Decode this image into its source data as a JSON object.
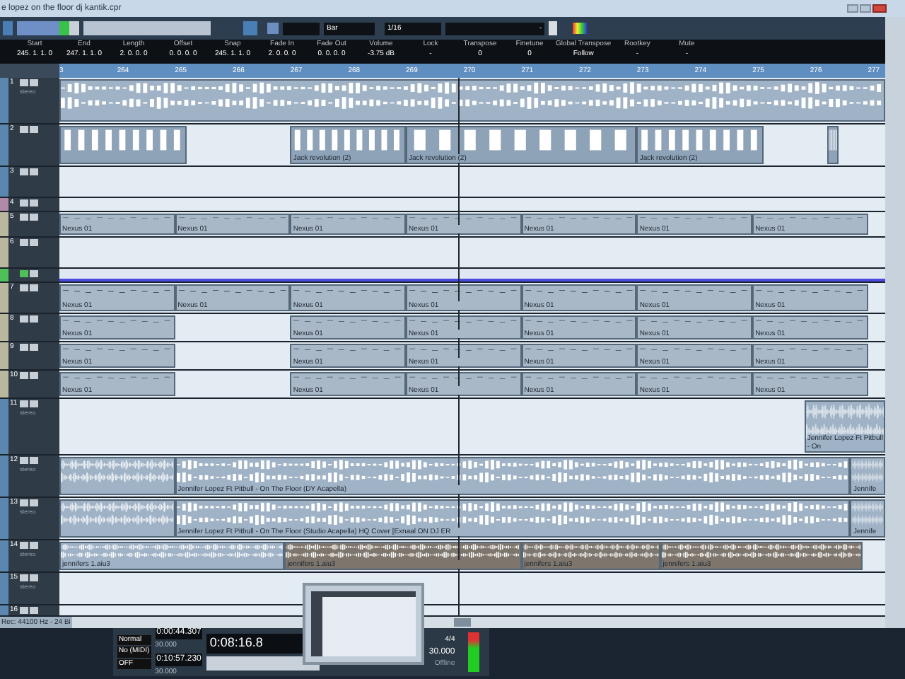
{
  "window": {
    "title": "e lopez on the floor dj kantik.cpr"
  },
  "toolbar": {
    "snap_type": "Bar",
    "quantize": "1/16",
    "nudge": "-"
  },
  "info_line": [
    {
      "label": "Start",
      "value": "245. 1. 1. 0"
    },
    {
      "label": "End",
      "value": "247. 1. 1. 0"
    },
    {
      "label": "Length",
      "value": "2. 0. 0. 0"
    },
    {
      "label": "Offset",
      "value": "0. 0. 0. 0"
    },
    {
      "label": "Snap",
      "value": "245. 1. 1. 0"
    },
    {
      "label": "Fade In",
      "value": "2. 0. 0. 0"
    },
    {
      "label": "Fade Out",
      "value": "0. 0. 0. 0"
    },
    {
      "label": "Volume",
      "value": "-3.75 dB"
    },
    {
      "label": "Lock",
      "value": "-"
    },
    {
      "label": "Transpose",
      "value": "0"
    },
    {
      "label": "Finetune",
      "value": "0"
    },
    {
      "label": "Global Transpose",
      "value": "Follow"
    },
    {
      "label": "Rootkey",
      "value": "-"
    },
    {
      "label": "Mute",
      "value": "-"
    }
  ],
  "ruler": [
    "3",
    "264",
    "265",
    "266",
    "267",
    "268",
    "269",
    "270",
    "271",
    "272",
    "273",
    "274",
    "275",
    "276",
    "277"
  ],
  "tracks": [
    {
      "number": "1",
      "kind": "audio",
      "color": "#5b86b0",
      "sub": "stereo"
    },
    {
      "number": "2",
      "kind": "pattern",
      "color": "#5b86b0",
      "events": [
        {
          "label": "Jack revolution (2)"
        },
        {
          "label": "Jack revolution (2)"
        },
        {
          "label": "Jack revolution (2)"
        }
      ]
    },
    {
      "number": "3",
      "kind": "midi",
      "color": "#5b86b0"
    },
    {
      "number": "4",
      "kind": "midi",
      "color": "#b08aa8"
    },
    {
      "number": "5",
      "kind": "midi",
      "color": "#b9b79d",
      "events": [
        {
          "label": "Nexus 01"
        },
        {
          "label": "Nexus 01"
        },
        {
          "label": "Nexus 01"
        },
        {
          "label": "Nexus 01"
        },
        {
          "label": "Nexus 01"
        },
        {
          "label": "Nexus 01"
        },
        {
          "label": "Nexus 01"
        }
      ]
    },
    {
      "number": "6",
      "kind": "midi",
      "color": "#b9b79d"
    },
    {
      "kind": "folder",
      "color": "#4fbf5a"
    },
    {
      "number": "7",
      "kind": "midi",
      "color": "#b9b79d",
      "events": [
        {
          "label": "Nexus 01"
        },
        {
          "label": "Nexus 01"
        },
        {
          "label": "Nexus 01"
        },
        {
          "label": "Nexus 01"
        },
        {
          "label": "Nexus 01"
        },
        {
          "label": "Nexus 01"
        },
        {
          "label": "Nexus 01"
        }
      ]
    },
    {
      "number": "8",
      "kind": "midi",
      "color": "#b9b79d",
      "events": [
        {
          "label": "Nexus 01"
        },
        {
          "label": "Nexus 01"
        },
        {
          "label": "Nexus 01"
        },
        {
          "label": "Nexus 01"
        },
        {
          "label": "Nexus 01"
        },
        {
          "label": "Nexus 01"
        }
      ]
    },
    {
      "number": "9",
      "kind": "midi",
      "color": "#b9b79d",
      "events": [
        {
          "label": "Nexus 01"
        },
        {
          "label": "Nexus 01"
        },
        {
          "label": "Nexus 01"
        },
        {
          "label": "Nexus 01"
        },
        {
          "label": "Nexus 01"
        },
        {
          "label": "Nexus 01"
        }
      ]
    },
    {
      "number": "10",
      "kind": "midi",
      "color": "#b9b79d",
      "events": [
        {
          "label": "Nexus 01"
        },
        {
          "label": "Nexus 01"
        },
        {
          "label": "Nexus 01"
        },
        {
          "label": "Nexus 01"
        },
        {
          "label": "Nexus 01"
        },
        {
          "label": "Nexus 01"
        }
      ]
    },
    {
      "number": "11",
      "kind": "audio",
      "color": "#5b86b0",
      "sub": "stereo",
      "events": [
        {
          "label": "Jennifer Lopez Ft Pitbull - On"
        }
      ]
    },
    {
      "number": "12",
      "kind": "audio",
      "color": "#5b86b0",
      "sub": "stereo",
      "events": [
        {
          "label": "Jennifer Lopez Ft Pitbull - On The Floor (DY Acapella)"
        },
        {
          "label": "Jennife"
        }
      ]
    },
    {
      "number": "13",
      "kind": "audio",
      "color": "#5b86b0",
      "sub": "stereo",
      "events": [
        {
          "label": "Jennifer Lopez Ft Pitbull - On The Floor (Studio Acapella) HQ Cover [Exnaal ON DJ ER"
        },
        {
          "label": "Jennife"
        }
      ]
    },
    {
      "number": "14",
      "kind": "audio",
      "color": "#5b86b0",
      "sub": "stereo",
      "events": [
        {
          "label": "jennifers 1.aiu3",
          "color": "#9fb2c6"
        },
        {
          "label": "jennifers 1.aiu3",
          "color": "#7e766c"
        },
        {
          "label": "jennifers 1.aiu3",
          "color": "#7e766c"
        },
        {
          "label": "jennifers 1.aiu3",
          "color": "#7e766c"
        }
      ]
    },
    {
      "number": "15",
      "kind": "audio",
      "color": "#5b86b0",
      "sub": "stereo"
    },
    {
      "number": "16",
      "kind": "audio",
      "color": "#5b86b0"
    }
  ],
  "status": "Rec: 44100 Hz - 24 Bi",
  "transport": {
    "mode": "Normal",
    "sync": "No (MIDI)",
    "click": "OFF",
    "left_locator": "0:00:44.307",
    "left_rate": "30.000",
    "right_locator": "0:10:57.230",
    "right_rate": "30.000",
    "position": "0:08:16.8",
    "signature": "4/4",
    "tempo": "30.000",
    "tempo_mode": "Offline"
  }
}
